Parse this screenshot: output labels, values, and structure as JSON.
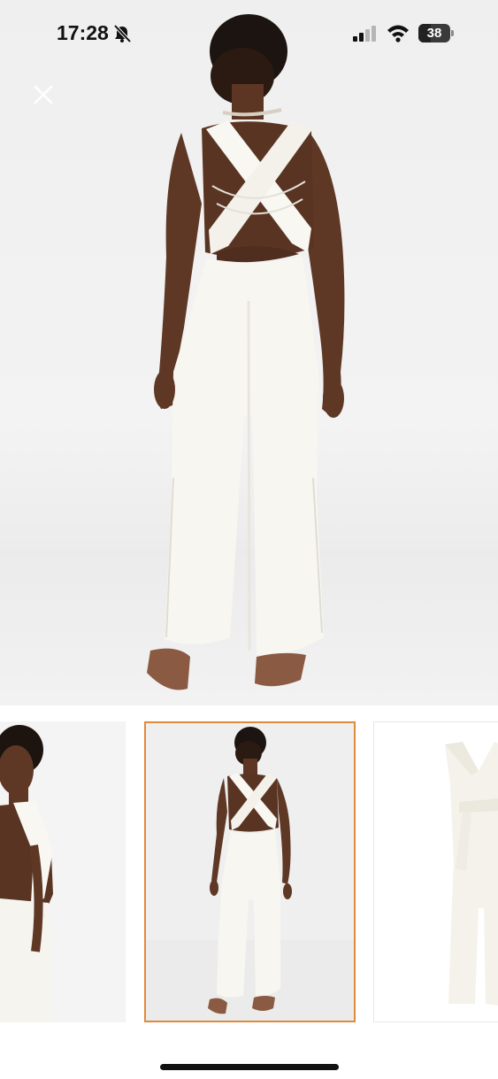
{
  "status_bar": {
    "time": "17:28",
    "battery_level": "38",
    "icons": [
      "bell-slash-icon",
      "cellular-signal-icon",
      "wifi-icon",
      "battery-icon"
    ]
  },
  "viewer": {
    "close_icon": "close-icon",
    "main_image": "jumpsuit-back-view",
    "thumbnails": [
      {
        "image": "jumpsuit-side-view",
        "selected": false
      },
      {
        "image": "jumpsuit-back-view",
        "selected": true
      },
      {
        "image": "jumpsuit-flat-front-view",
        "selected": false
      }
    ]
  },
  "colors": {
    "selected_border": "#e08a3c",
    "garment": "#f7f6f1",
    "skin": "#6b3f2a"
  }
}
